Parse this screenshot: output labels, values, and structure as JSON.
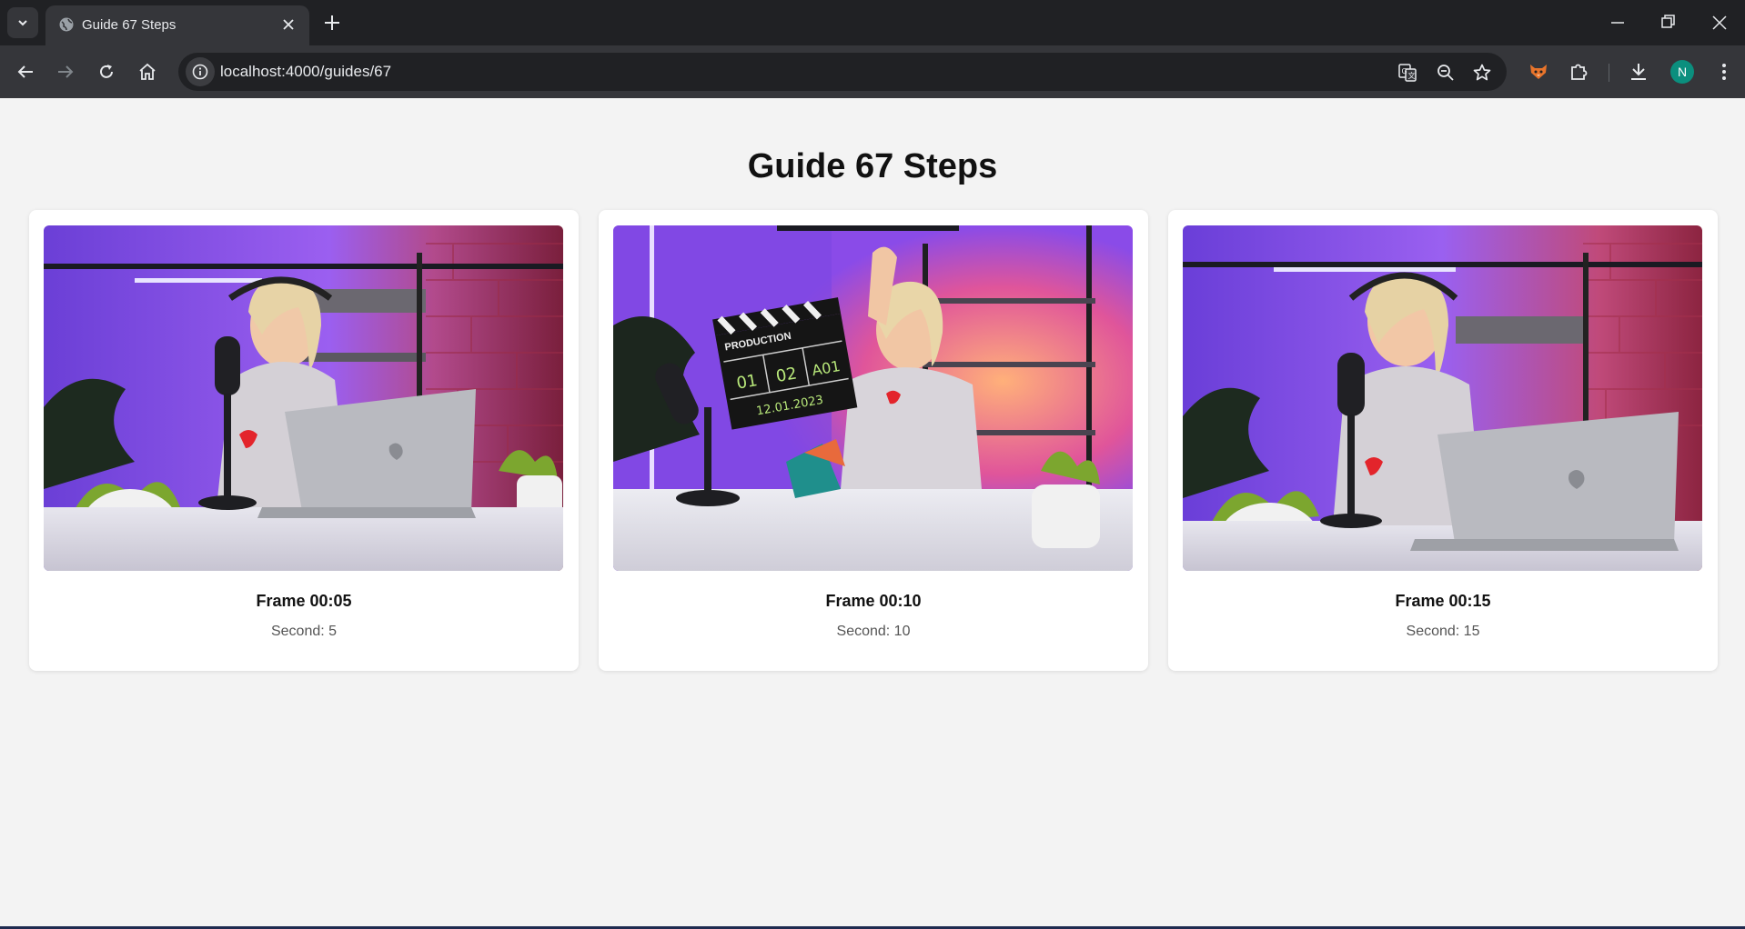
{
  "browser": {
    "tab_title": "Guide 67 Steps",
    "url": "localhost:4000/guides/67",
    "profile_initial": "N",
    "accent_color": "#0b8f7e"
  },
  "page": {
    "title": "Guide 67 Steps",
    "frames": [
      {
        "title": "Frame 00:05",
        "subtitle": "Second: 5",
        "image": "woman-podcaster-at-laptop"
      },
      {
        "title": "Frame 00:10",
        "subtitle": "Second: 10",
        "image": "woman-holding-clapperboard"
      },
      {
        "title": "Frame 00:15",
        "subtitle": "Second: 15",
        "image": "woman-podcaster-smiling-at-laptop"
      }
    ]
  },
  "clapperboard": {
    "heading": "PRODUCTION",
    "scene": "01",
    "take": "02",
    "roll": "A01",
    "date": "12.01.2023"
  }
}
